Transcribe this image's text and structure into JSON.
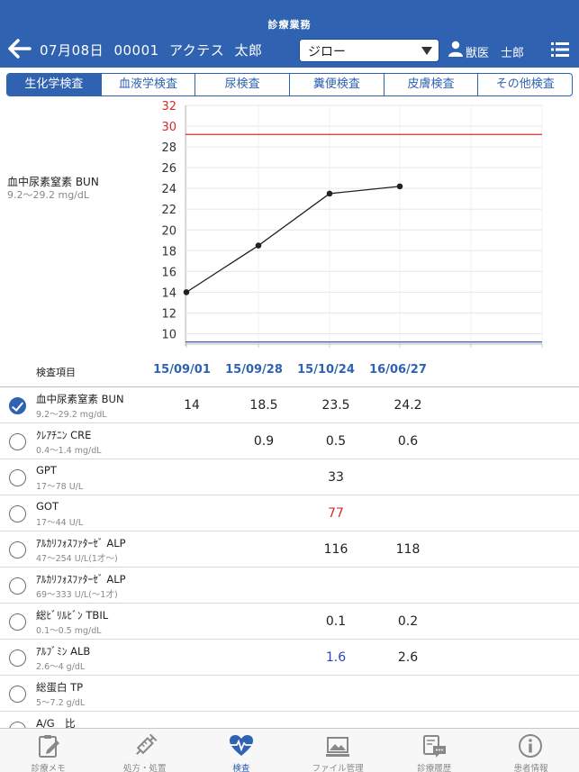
{
  "header": {
    "title": "診療業務",
    "date": "07月08日",
    "patient_id": "00001",
    "owner": "アクテス",
    "pet": "太郎",
    "pet_select": "ジロー",
    "vet_label": "獣医",
    "vet_name": "士郎"
  },
  "tabs": [
    "生化学検査",
    "血液学検査",
    "尿検査",
    "糞便検査",
    "皮膚検査",
    "その他検査"
  ],
  "active_tab": 0,
  "chart_info": {
    "name": "血中尿素窒素 BUN",
    "range": "9.2～29.2 mg/dL"
  },
  "chart_data": {
    "type": "line",
    "x": [
      "15/09/01",
      "15/09/28",
      "15/10/24",
      "16/06/27"
    ],
    "series": [
      {
        "values": [
          14,
          18.5,
          23.5,
          24.2
        ]
      }
    ],
    "y_ticks": [
      10,
      12,
      14,
      16,
      18,
      20,
      22,
      24,
      26,
      28,
      30,
      32
    ],
    "ylim": [
      9,
      32
    ],
    "upper_limit": 29.2,
    "lower_limit": 9.2,
    "upper_color": "#d62b2b",
    "lower_color": "#1f3faf",
    "line_color": "#222222",
    "grid": true
  },
  "table": {
    "item_header": "検査項目",
    "dates": [
      "15/09/01",
      "15/09/28",
      "15/10/24",
      "16/06/27"
    ],
    "rows": [
      {
        "name": "血中尿素窒素 BUN",
        "range": "9.2～29.2 mg/dL",
        "checked": true,
        "values": [
          "14",
          "18.5",
          "23.5",
          "24.2"
        ],
        "flags": [
          "",
          "",
          "",
          ""
        ]
      },
      {
        "name": "ｸﾚｱﾁﾆﾝ CRE",
        "range": "0.4～1.4 mg/dL",
        "checked": false,
        "values": [
          "",
          "0.9",
          "0.5",
          "0.6"
        ],
        "flags": [
          "",
          "",
          "",
          ""
        ]
      },
      {
        "name": "GPT",
        "range": "17～78 U/L",
        "checked": false,
        "values": [
          "",
          "",
          "33",
          ""
        ],
        "flags": [
          "",
          "",
          "",
          ""
        ]
      },
      {
        "name": "GOT",
        "range": "17～44 U/L",
        "checked": false,
        "values": [
          "",
          "",
          "77",
          ""
        ],
        "flags": [
          "",
          "",
          "high",
          ""
        ]
      },
      {
        "name": "ｱﾙｶﾘﾌｫｽﾌｧﾀｰｾﾞ ALP",
        "range": "47～254 U/L(1才～)",
        "checked": false,
        "values": [
          "",
          "",
          "116",
          "118"
        ],
        "flags": [
          "",
          "",
          "",
          ""
        ]
      },
      {
        "name": "ｱﾙｶﾘﾌｫｽﾌｧﾀｰｾﾞ ALP",
        "range": "69～333 U/L(～1才)",
        "checked": false,
        "values": [
          "",
          "",
          "",
          ""
        ],
        "flags": [
          "",
          "",
          "",
          ""
        ]
      },
      {
        "name": "総ﾋﾞﾘﾙﾋﾞﾝ TBIL",
        "range": "0.1～0.5 mg/dL",
        "checked": false,
        "values": [
          "",
          "",
          "0.1",
          "0.2"
        ],
        "flags": [
          "",
          "",
          "",
          ""
        ]
      },
      {
        "name": "ｱﾙﾌﾞﾐﾝ ALB",
        "range": "2.6～4 g/dL",
        "checked": false,
        "values": [
          "",
          "",
          "1.6",
          "2.6"
        ],
        "flags": [
          "",
          "",
          "low",
          ""
        ]
      },
      {
        "name": "総蛋白 TP",
        "range": "5～7.2 g/dL",
        "checked": false,
        "values": [
          "",
          "",
          "",
          ""
        ],
        "flags": [
          "",
          "",
          "",
          ""
        ]
      },
      {
        "name": "A/G　比",
        "range": "",
        "checked": false,
        "values": [
          "",
          "",
          "",
          ""
        ],
        "flags": [
          "",
          "",
          "",
          ""
        ]
      }
    ]
  },
  "tabbar": {
    "items": [
      {
        "label": "診療メモ",
        "icon": "memo-icon"
      },
      {
        "label": "処方・処置",
        "icon": "syringe-icon"
      },
      {
        "label": "検査",
        "icon": "heart-pulse-icon"
      },
      {
        "label": "ファイル管理",
        "icon": "image-file-icon"
      },
      {
        "label": "診療履歴",
        "icon": "history-chat-icon"
      },
      {
        "label": "患者情報",
        "icon": "info-icon"
      }
    ],
    "active": 2,
    "accent": "#2f62b0"
  }
}
